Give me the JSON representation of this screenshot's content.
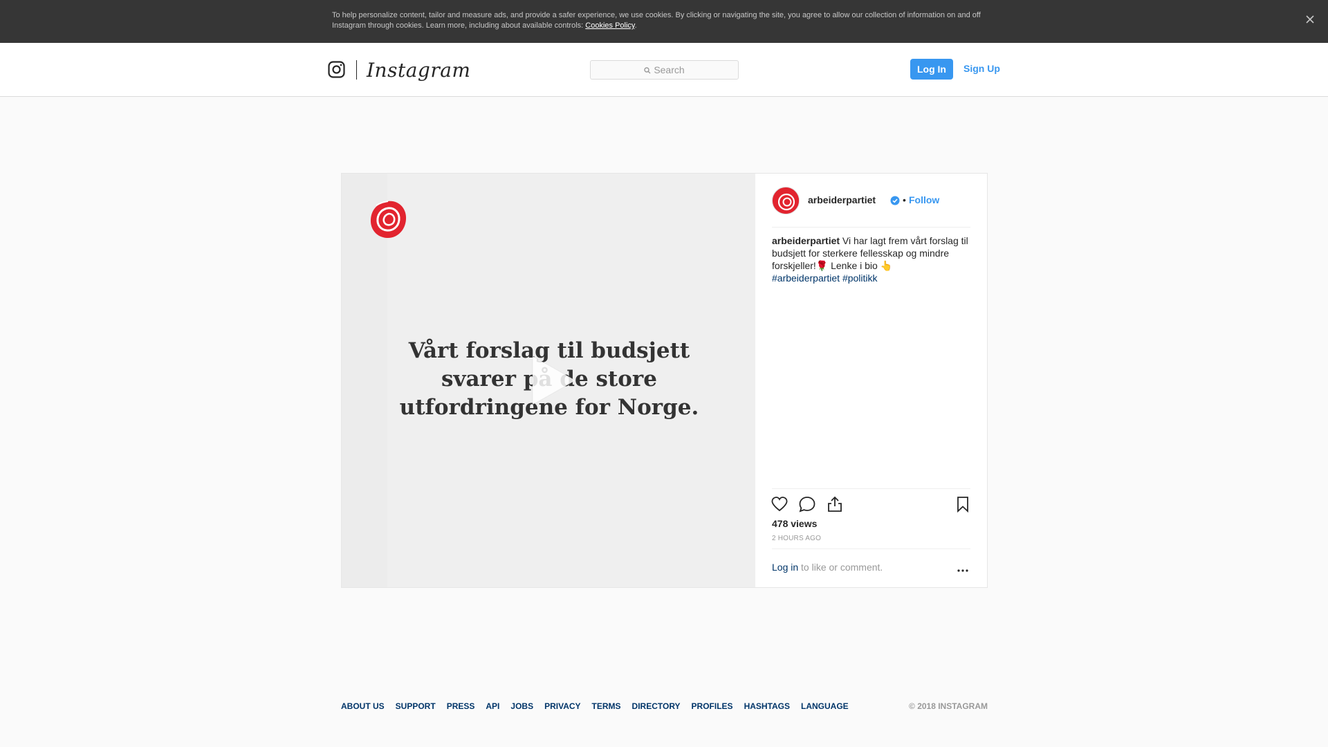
{
  "cookie_banner": {
    "text": "To help personalize content, tailor and measure ads, and provide a safer experience, we use cookies. By clicking or navigating the site, you agree to allow our collection of information on and off Instagram through cookies. Learn more, including about available controls: ",
    "link_label": "Cookies Policy",
    "link_suffix": ".",
    "close_icon": "close-icon"
  },
  "nav": {
    "wordmark": "Instagram",
    "search_placeholder": "Search",
    "login_label": "Log In",
    "signup_label": "Sign Up",
    "icons": [
      "instagram-camera-icon",
      "search-icon"
    ]
  },
  "post": {
    "media": {
      "headline": "Vårt forslag til budsjett svarer på de store utfordringene for Norge.",
      "icons": [
        "rose-logo-icon",
        "play-icon"
      ]
    },
    "author": {
      "username": "arbeiderpartiet",
      "dot": "•",
      "follow_label": "Follow",
      "icons": [
        "avatar",
        "verified-badge-icon"
      ]
    },
    "caption": {
      "username": "arbeiderpartiet",
      "text": " Vi har lagt frem vårt forslag til budsjett for sterkere fellesskap og mindre forskjeller!🌹 Lenke i bio 👆",
      "hashtags": [
        "#arbeiderpartiet",
        "#politikk"
      ]
    },
    "actions": {
      "icons": [
        "heart-icon",
        "comment-icon",
        "share-icon",
        "bookmark-icon"
      ]
    },
    "views": "478 views",
    "timestamp": "2 HOURS AGO",
    "comment_prompt": {
      "login_label": "Log in",
      "rest": " to like or comment."
    },
    "more_icon": "more-options-icon"
  },
  "footer": {
    "links": [
      "ABOUT US",
      "SUPPORT",
      "PRESS",
      "API",
      "JOBS",
      "PRIVACY",
      "TERMS",
      "DIRECTORY",
      "PROFILES",
      "HASHTAGS",
      "LANGUAGE"
    ],
    "copyright": "© 2018 INSTAGRAM"
  },
  "colors": {
    "brand_blue": "#3897f0",
    "link_dark": "#003569",
    "rose_red": "#e2242f",
    "banner_bg": "#363636"
  }
}
